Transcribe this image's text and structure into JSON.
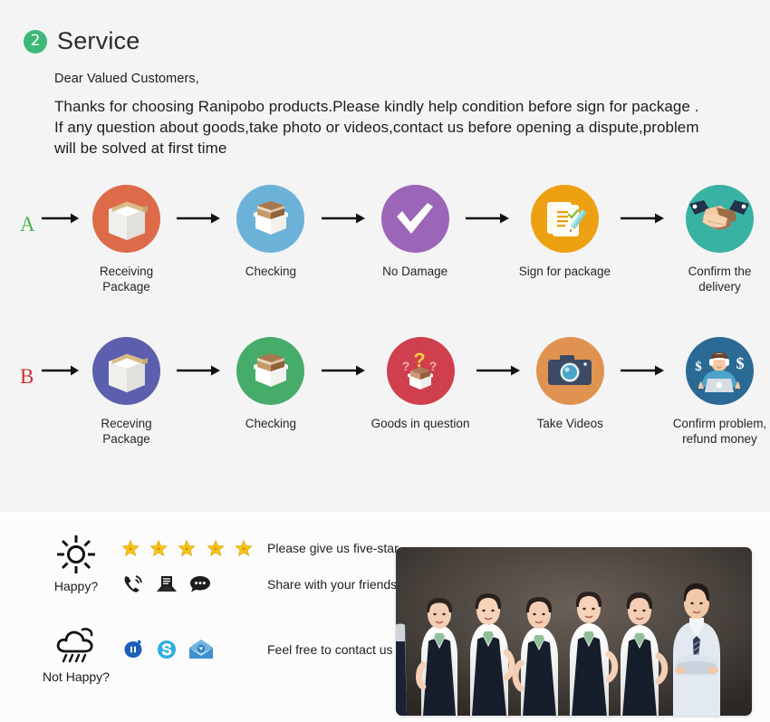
{
  "header": {
    "badge_number": "2",
    "title": "Service",
    "badge_color": "#3cb878"
  },
  "intro": {
    "greeting": "Dear Valued Customers,",
    "line1": "Thanks for choosing Ranipobo products.Please kindly help condition before sign for package .",
    "line2": "If any question about goods,take photo or videos,contact us before opening a dispute,problem",
    "line3": "will be solved at first time"
  },
  "flows": [
    {
      "letter": "A",
      "letter_color": "#4caf50",
      "steps": [
        {
          "label": "Receiving Package",
          "icon": "white-box-icon",
          "color": "#dd6b4a"
        },
        {
          "label": "Checking",
          "icon": "open-carton-icon",
          "color": "#6cb2d8"
        },
        {
          "label": "No Damage",
          "icon": "checkmark-icon",
          "color": "#9b66b7"
        },
        {
          "label": "Sign for package",
          "icon": "clipboard-pencil-icon",
          "color": "#eda012"
        },
        {
          "label": "Confirm the delivery",
          "icon": "handshake-icon",
          "color": "#38b2a3"
        }
      ]
    },
    {
      "letter": "B",
      "letter_color": "#d0322e",
      "steps": [
        {
          "label": "Receving Package",
          "icon": "white-box-icon",
          "color": "#5b5fad"
        },
        {
          "label": "Checking",
          "icon": "open-carton-icon",
          "color": "#46ac6a"
        },
        {
          "label": "Goods in question",
          "icon": "question-box-icon",
          "color": "#cf3f4d"
        },
        {
          "label": "Take Videos",
          "icon": "camera-icon",
          "color": "#e09350"
        },
        {
          "label": "Confirm problem,\nrefund money",
          "icon": "support-agent-icon",
          "color": "#2a6a94"
        }
      ]
    }
  ],
  "contact": {
    "happy": {
      "icon": "sun-icon",
      "label": "Happy?",
      "lines": [
        {
          "icons": [
            "star-icon",
            "star-icon",
            "star-icon",
            "star-icon",
            "star-icon"
          ],
          "caption": "Please give us five-star"
        },
        {
          "icons": [
            "phone-ring-icon",
            "envelope-icon",
            "chat-bubble-icon"
          ],
          "caption": "Share with your friends"
        }
      ]
    },
    "not_happy": {
      "icon": "rain-cloud-icon",
      "label": "Not Happy?",
      "lines": [
        {
          "icons": [
            "trademanager-icon",
            "skype-icon",
            "open-mail-icon"
          ],
          "caption": "Feel free to contact us"
        }
      ]
    },
    "photo_alt": "customer-service-team-photo"
  },
  "colors": {
    "star": "#f5c518",
    "top_bg": "#f4f4f5",
    "bottom_bg": "#fcfcfd"
  }
}
